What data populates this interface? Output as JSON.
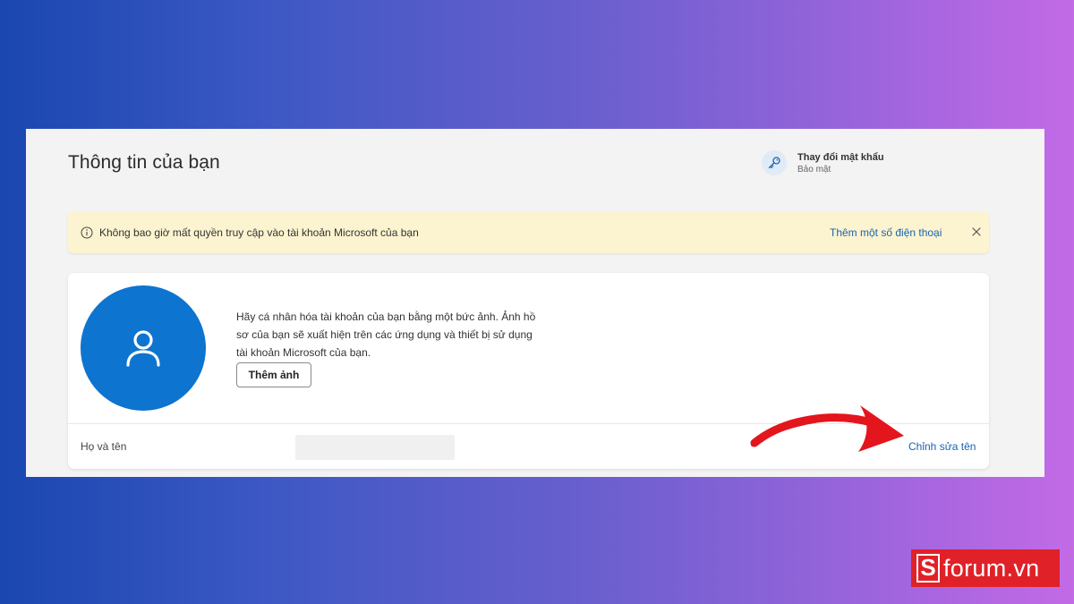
{
  "page": {
    "title": "Thông tin của bạn"
  },
  "password_link": {
    "title": "Thay đổi mật khẩu",
    "subtitle": "Bảo mật",
    "icon": "key-icon"
  },
  "banner": {
    "icon": "info-icon",
    "text": "Không bao giờ mất quyền truy cập vào tài khoản Microsoft của bạn",
    "link": "Thêm một số điện thoại",
    "close_icon": "close-icon",
    "background": "#fcf4d0"
  },
  "profile": {
    "avatar_icon": "person-icon",
    "avatar_color": "#0d74cf",
    "description": "Hãy cá nhân hóa tài khoản của bạn bằng một bức ảnh. Ảnh hồ sơ của bạn sẽ xuất hiện trên các ứng dụng và thiết bị sử dụng tài khoản Microsoft của bạn.",
    "add_photo_label": "Thêm ảnh",
    "name_label": "Họ và tên",
    "name_value": "",
    "edit_name_link": "Chỉnh sửa tên"
  },
  "annotation": {
    "arrow_icon": "red-arrow-icon",
    "color": "#e3161d"
  },
  "watermark": {
    "logo_letter": "S",
    "logo_text": "forum.vn",
    "color": "#e02128"
  },
  "colors": {
    "link": "#1a62b3",
    "accent": "#0d74cf"
  }
}
